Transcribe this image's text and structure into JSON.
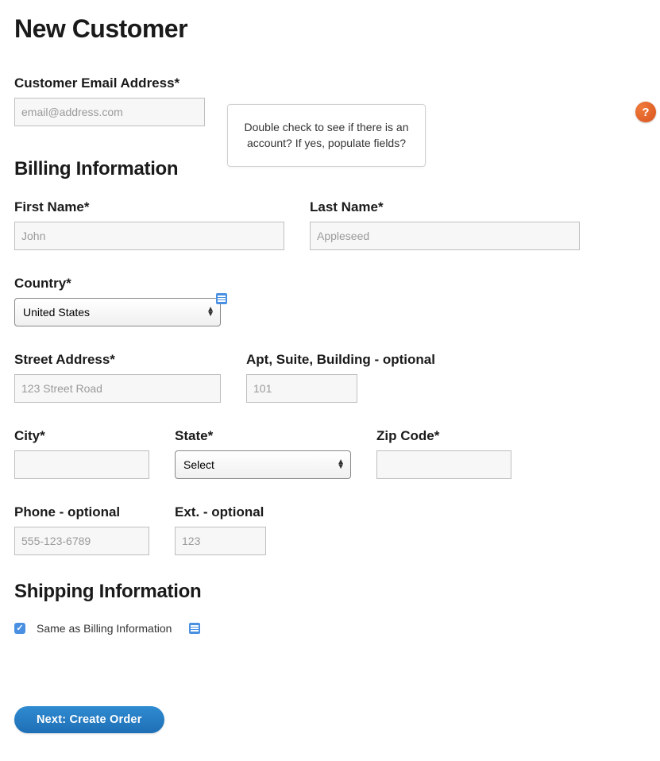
{
  "page_title": "New Customer",
  "email": {
    "label": "Customer Email Address*",
    "placeholder": "email@address.com",
    "help_icon": "?",
    "tooltip": "Double check to see if there is an account? If yes, populate fields?"
  },
  "billing": {
    "title": "Billing Information",
    "first_name": {
      "label": "First Name*",
      "placeholder": "John"
    },
    "last_name": {
      "label": "Last Name*",
      "placeholder": "Appleseed"
    },
    "country": {
      "label": "Country*",
      "selected": "United States"
    },
    "street": {
      "label": "Street Address*",
      "placeholder": "123 Street Road"
    },
    "apt": {
      "label": "Apt, Suite, Building - optional",
      "placeholder": "101"
    },
    "city": {
      "label": "City*"
    },
    "state": {
      "label": "State*",
      "selected": "Select"
    },
    "zip": {
      "label": "Zip Code*"
    },
    "phone": {
      "label": "Phone - optional",
      "placeholder": "555-123-6789"
    },
    "ext": {
      "label": "Ext. - optional",
      "placeholder": "123"
    }
  },
  "shipping": {
    "title": "Shipping Information",
    "same_as_billing_label": "Same as Billing Information",
    "same_as_billing_checked": true
  },
  "actions": {
    "next_label": "Next: Create Order"
  }
}
